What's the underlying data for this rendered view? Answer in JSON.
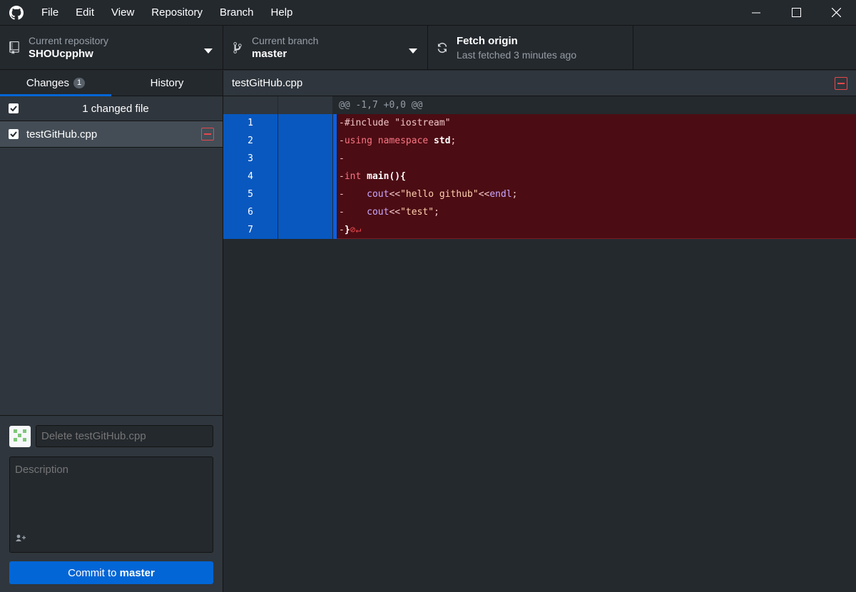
{
  "menu": [
    "File",
    "Edit",
    "View",
    "Repository",
    "Branch",
    "Help"
  ],
  "toolbar": {
    "repo_label": "Current repository",
    "repo_value": "SHOUcpphw",
    "branch_label": "Current branch",
    "branch_value": "master",
    "fetch_label": "Fetch origin",
    "fetch_sub": "Last fetched 3 minutes ago"
  },
  "tabs": {
    "changes": "Changes",
    "changes_count": "1",
    "history": "History"
  },
  "changes": {
    "header": "1 changed file",
    "files": [
      {
        "name": "testGitHub.cpp",
        "status": "deleted"
      }
    ]
  },
  "commit": {
    "summary_placeholder": "Delete testGitHub.cpp",
    "description_placeholder": "Description",
    "button_prefix": "Commit to ",
    "button_branch": "master"
  },
  "diff": {
    "file": "testGitHub.cpp",
    "hunk": "@@ -1,7 +0,0 @@",
    "lines": [
      {
        "n": "1",
        "prefix": "-",
        "parts": [
          [
            "",
            "#include \"iostream\""
          ]
        ]
      },
      {
        "n": "2",
        "prefix": "-",
        "parts": [
          [
            "kw",
            "using namespace"
          ],
          [
            "fn",
            " std"
          ],
          [
            "",
            ";"
          ]
        ]
      },
      {
        "n": "3",
        "prefix": "-",
        "parts": []
      },
      {
        "n": "4",
        "prefix": "-",
        "parts": [
          [
            "kw",
            "int"
          ],
          [
            "",
            " "
          ],
          [
            "fn",
            "main(){"
          ]
        ]
      },
      {
        "n": "5",
        "prefix": "-",
        "parts": [
          [
            "",
            "    "
          ],
          [
            "id",
            "cout"
          ],
          [
            "",
            "<<"
          ],
          [
            "str",
            "\"hello github\""
          ],
          [
            "",
            "<<"
          ],
          [
            "id",
            "endl"
          ],
          [
            "",
            ";"
          ]
        ]
      },
      {
        "n": "6",
        "prefix": "-",
        "parts": [
          [
            "",
            "    "
          ],
          [
            "id",
            "cout"
          ],
          [
            "",
            "<<"
          ],
          [
            "str",
            "\"test\""
          ],
          [
            "",
            ";"
          ]
        ]
      },
      {
        "n": "7",
        "prefix": "-",
        "parts": [
          [
            "fn",
            "}"
          ],
          [
            "noeol",
            "⊘↵"
          ]
        ]
      }
    ]
  },
  "colors": {
    "accent": "#0366d6",
    "deleted": "#e5484d",
    "deleted_bg": "#4c0c13"
  },
  "icons": [
    "github-logo-icon",
    "repo-icon",
    "branch-icon",
    "sync-icon",
    "caret-down-icon",
    "minimize-icon",
    "maximize-icon",
    "close-icon",
    "checkbox-icon",
    "file-deleted-icon",
    "add-coauthor-icon"
  ]
}
